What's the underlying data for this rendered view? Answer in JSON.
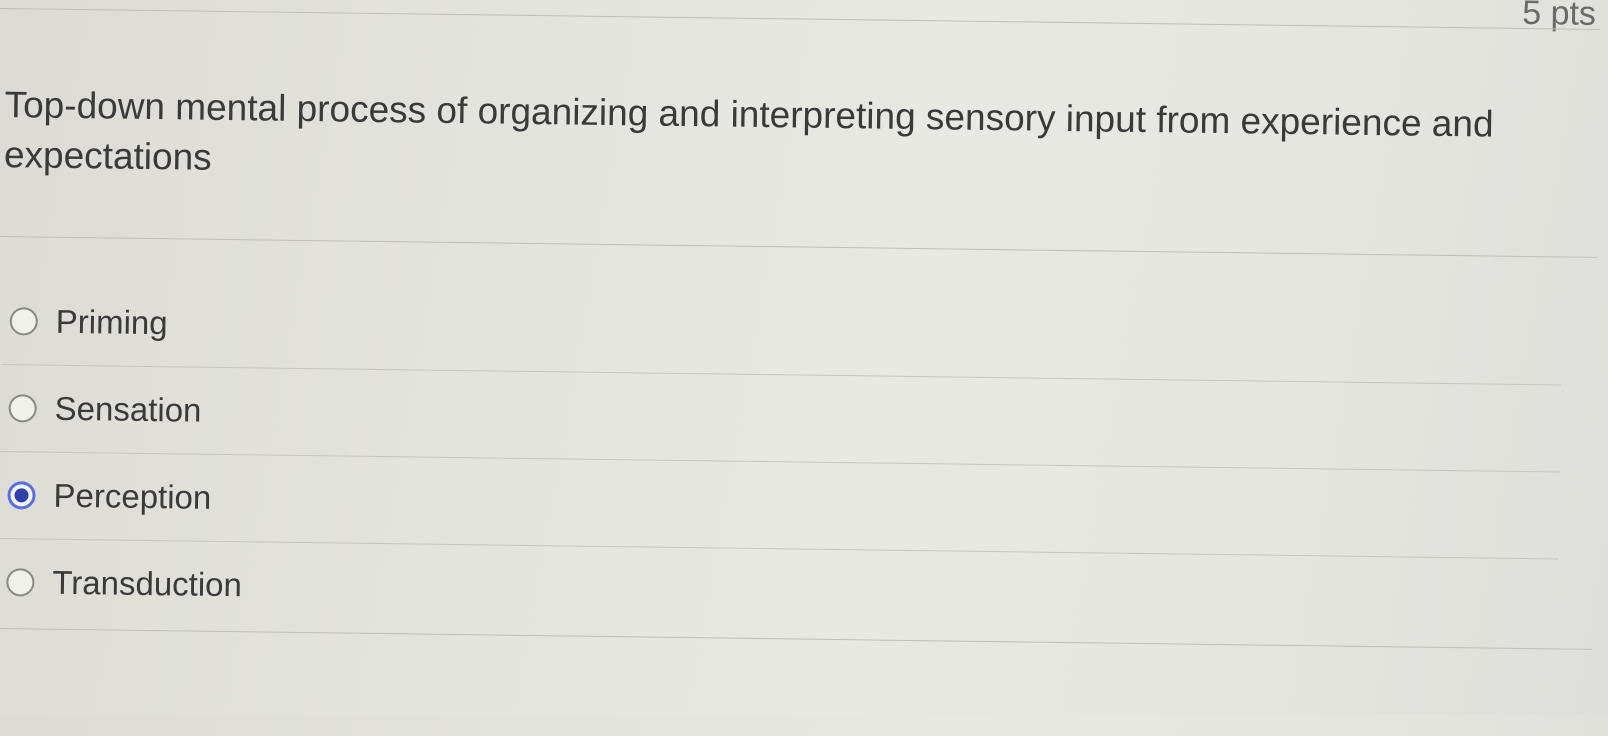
{
  "question": {
    "points_label": "5 pts",
    "prompt": "Top-down mental process of organizing and interpreting sensory input from experience and expectations"
  },
  "options": [
    {
      "label": "Priming",
      "selected": false
    },
    {
      "label": "Sensation",
      "selected": false
    },
    {
      "label": "Perception",
      "selected": true
    },
    {
      "label": "Transduction",
      "selected": false
    }
  ],
  "colors": {
    "radio_selected": "#2f40a8",
    "radio_selected_ring": "#5a6ee0"
  }
}
